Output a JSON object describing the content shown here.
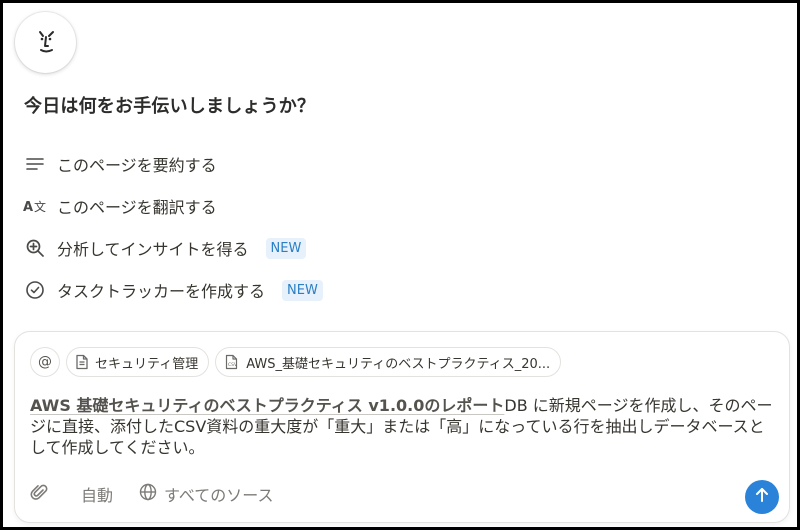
{
  "assistant": {
    "avatar_icon": "notion-ai-face-icon"
  },
  "heading": "今日は何をお手伝いしましょうか？",
  "suggestions": [
    {
      "label": "このページを要約する",
      "icon": "summary-lines-icon",
      "badge": ""
    },
    {
      "label": "このページを翻訳する",
      "icon": "translate-icon",
      "badge": ""
    },
    {
      "label": "分析してインサイトを得る",
      "icon": "zoom-analysis-icon",
      "badge": "NEW"
    },
    {
      "label": "タスクトラッカーを作成する",
      "icon": "check-circle-icon",
      "badge": "NEW"
    }
  ],
  "composer": {
    "mention_symbol": "@",
    "context_chips": [
      {
        "label": "セキュリティ管理",
        "icon": "page-icon"
      },
      {
        "label": "AWS_基礎セキュリティのベストプラクティス_20...",
        "icon": "csv-file-icon"
      }
    ],
    "message": {
      "mention": "AWS 基礎セキュリティのベストプラクティス v1.0.0のレポート",
      "mention_suffix": "DB",
      "text": " に新規ページを作成し、そのページに直接、添付したCSV資料の重大度が「重大」または「高」になっている行を抽出しデータベースとして作成してください。"
    },
    "toolbar": {
      "attach_icon": "paperclip-icon",
      "mode_label": "自動",
      "sources_label": "すべてのソース",
      "sources_icon": "globe-icon"
    },
    "send_icon": "arrow-up-icon"
  },
  "colors": {
    "accent": "#2a83d9",
    "badge_text": "#2b7fc4",
    "badge_bg": "#e6f1fb",
    "text": "#37352f",
    "muted": "#7d7b77"
  }
}
